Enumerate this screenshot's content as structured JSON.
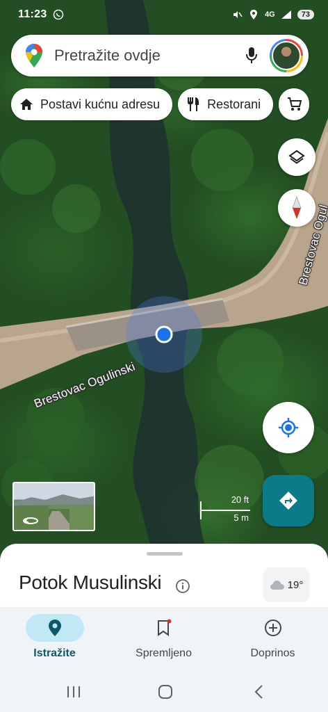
{
  "status_bar": {
    "time": "11:23",
    "network": "4G",
    "battery": "73",
    "icons": [
      "whatsapp-icon",
      "mute-icon",
      "location-icon",
      "signal-icon"
    ]
  },
  "search": {
    "placeholder": "Pretražite ovdje",
    "icons": [
      "google-maps-pin-icon",
      "mic-icon",
      "avatar"
    ]
  },
  "chips": [
    {
      "label": "Postavi kućnu adresu",
      "icon": "home-icon"
    },
    {
      "label": "Restorani",
      "icon": "restaurant-icon"
    },
    {
      "label": "",
      "icon": "shopping-cart-icon"
    }
  ],
  "map": {
    "road_labels": [
      "Brestovac Ogulinski",
      "Brestovac Ogul"
    ],
    "scale_ft": "20 ft",
    "scale_m": "5 m",
    "buttons": [
      "layers-icon",
      "compass-icon",
      "my-location-icon",
      "directions-icon"
    ],
    "colors": {
      "location_blue": "#1a73e8",
      "directions_teal": "#0b7b8a"
    }
  },
  "sheet": {
    "title": "Potok Musulinski",
    "weather_temp": "19°",
    "weather_icon": "cloud-icon"
  },
  "nav": {
    "items": [
      {
        "label": "Istražite",
        "icon": "explore-pin-icon",
        "active": true
      },
      {
        "label": "Spremljeno",
        "icon": "bookmark-icon",
        "active": false
      },
      {
        "label": "Doprinos",
        "icon": "add-circle-icon",
        "active": false
      }
    ]
  },
  "system_nav": [
    "recents-icon",
    "home-icon",
    "back-icon"
  ]
}
